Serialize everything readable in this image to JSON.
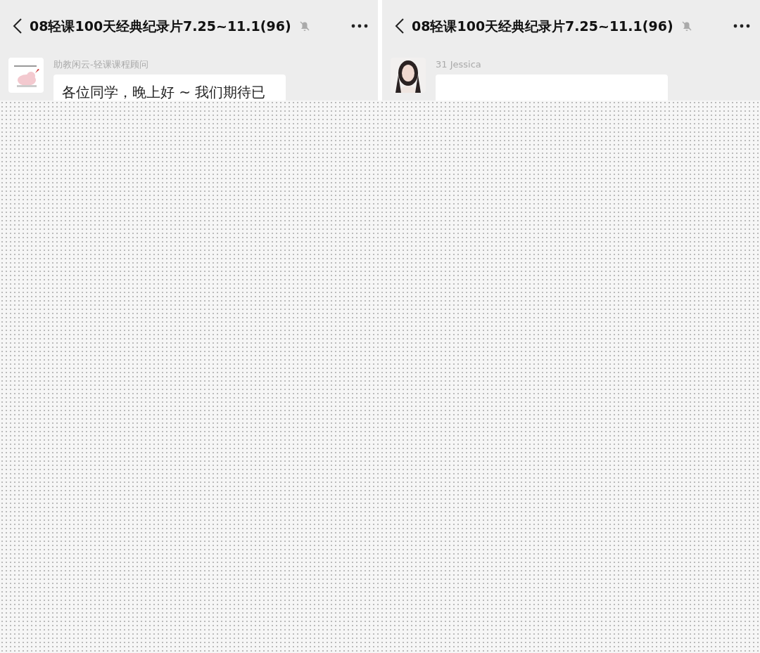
{
  "panels": [
    {
      "title": "08轻课100天经典纪录片7.25~11.1(96)",
      "muted": true,
      "message": {
        "sender": "助教闲云-轻课课程顾问",
        "text": "各位同学，晚上好 ~ 我们期待已"
      }
    },
    {
      "title": "08轻课100天经典纪录片7.25~11.1(96)",
      "muted": true,
      "message": {
        "sender": "31 Jessica"
      }
    }
  ]
}
